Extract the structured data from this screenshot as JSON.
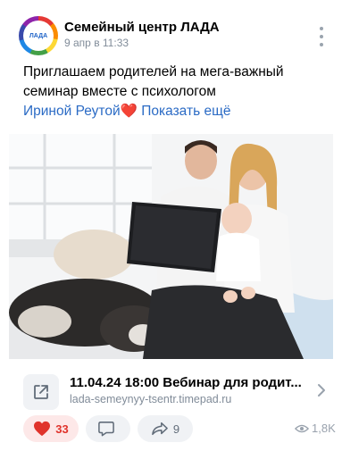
{
  "post": {
    "author": "Семейный центр ЛАДА",
    "date": "9 апр в 11:33",
    "avatar_text": "ЛАДА",
    "text_line1": "Приглашаем родителей на мега-важный",
    "text_line2": "семинар вместе с психологом",
    "text_name": "Ириной Реутой",
    "text_heart": "❤️",
    "show_more": "Показать ещё"
  },
  "link_card": {
    "title": "11.04.24 18:00 Вебинар для родит...",
    "url": "lada-semeynyy-tsentr.timepad.ru"
  },
  "actions": {
    "likes": "33",
    "comments": "",
    "shares": "9",
    "views": "1,8K"
  },
  "colors": {
    "accent": "#2b6bc5",
    "like": "#e0332b",
    "muted": "#818c99"
  }
}
